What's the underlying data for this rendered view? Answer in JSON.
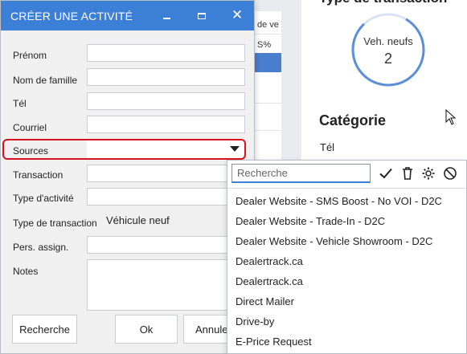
{
  "background": {
    "section_title": "Type de transaction",
    "donut_label": "Veh. neufs",
    "donut_value": "2",
    "category_title": "Catégorie",
    "category_row": "Tél",
    "table_header_1": "de ve",
    "table_header_2": "S%"
  },
  "dialog": {
    "title": "CRÉER UNE ACTIVITÉ",
    "fields": {
      "prenom": "Prénom",
      "nom": "Nom de famille",
      "tel": "Tél",
      "courriel": "Courriel",
      "sources": "Sources",
      "transaction": "Transaction",
      "type_activite": "Type d'activité",
      "type_transaction": "Type de transaction",
      "pers_assign": "Pers. assign.",
      "notes": "Notes"
    },
    "type_transaction_value": "Véhicule neuf",
    "buttons": {
      "search": "Recherche",
      "ok": "Ok",
      "cancel": "Annuler"
    }
  },
  "dropdown": {
    "search_placeholder": "Recherche",
    "options": [
      "Dealer Website - SMS Boost - No VOI - D2C",
      "Dealer Website - Trade-In - D2C",
      "Dealer Website - Vehicle Showroom - D2C",
      "Dealertrack.ca",
      "Dealertrack.ca",
      "Direct Mailer",
      "Drive-by",
      "E-Price Request"
    ]
  },
  "colors": {
    "accent": "#3c7fd6",
    "highlight": "#e0101d"
  },
  "icons": [
    "check-icon",
    "trash-icon",
    "gear-icon",
    "ban-icon",
    "minimize-icon",
    "maximize-icon",
    "close-icon",
    "caret-down-icon",
    "cursor-icon"
  ]
}
